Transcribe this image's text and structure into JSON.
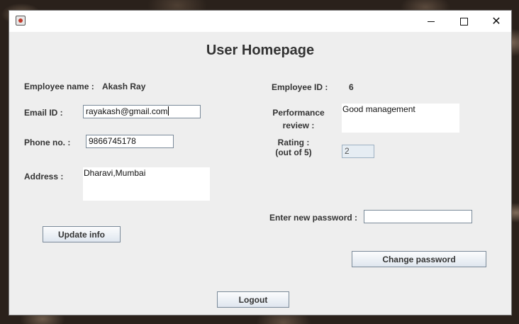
{
  "window": {
    "title": "",
    "icons": {
      "app": "java-cup-icon",
      "minimize": "minimize-icon",
      "maximize": "maximize-icon",
      "close": "close-icon"
    },
    "close_glyph": "✕"
  },
  "page": {
    "title": "User Homepage"
  },
  "employee": {
    "name_label": "Employee name :",
    "name_value": "Akash Ray",
    "email_label": "Email ID :",
    "email_value": "rayakash@gmail.com",
    "phone_label": "Phone no. :",
    "phone_value": "9866745178",
    "address_label": "Address :",
    "address_value": "Dharavi,Mumbai",
    "id_label": "Employee ID :",
    "id_value": "6",
    "review_label_line1": "Performance",
    "review_label_line2": "review :",
    "review_value": "Good management",
    "rating_label_line1": "Rating :",
    "rating_label_line2": "(out of 5)",
    "rating_value": "2"
  },
  "password": {
    "label": "Enter new password :",
    "value": ""
  },
  "buttons": {
    "update": "Update info",
    "change_password": "Change password",
    "logout": "Logout"
  }
}
